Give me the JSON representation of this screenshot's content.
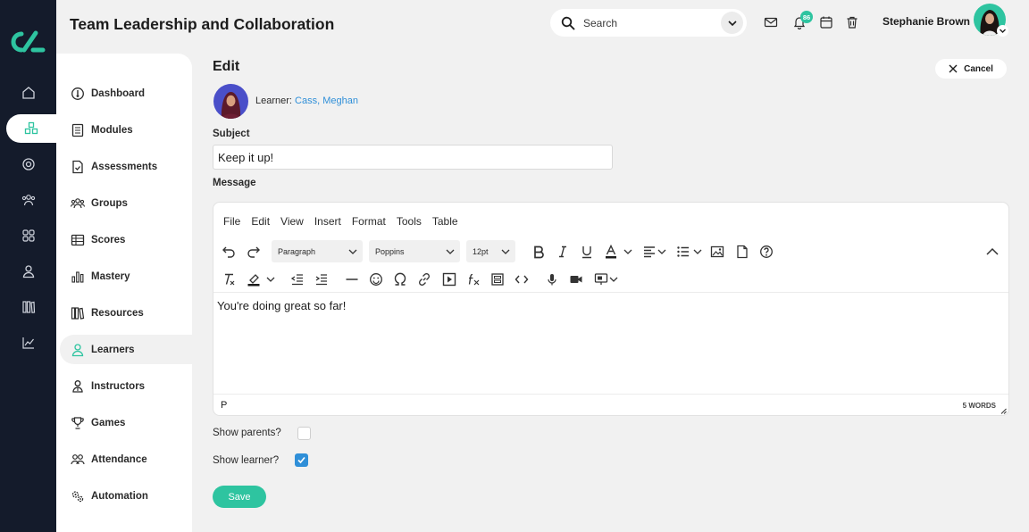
{
  "header": {
    "title": "Team Leadership and Collaboration",
    "search_label": "Search",
    "notification_count": "86",
    "user_name": "Stephanie Brown"
  },
  "rail": {
    "icons": [
      "home-icon",
      "modules-icon",
      "target-icon",
      "people-icon",
      "grid-icon",
      "user-icon",
      "library-icon",
      "chart-icon"
    ],
    "active_index": 1
  },
  "sidebar": {
    "items": [
      {
        "label": "Dashboard",
        "icon": "dashboard-icon"
      },
      {
        "label": "Modules",
        "icon": "book-icon"
      },
      {
        "label": "Assessments",
        "icon": "document-check-icon"
      },
      {
        "label": "Groups",
        "icon": "group-icon"
      },
      {
        "label": "Scores",
        "icon": "table-icon"
      },
      {
        "label": "Mastery",
        "icon": "bar-chart-icon"
      },
      {
        "label": "Resources",
        "icon": "books-icon"
      },
      {
        "label": "Learners",
        "icon": "user-icon"
      },
      {
        "label": "Instructors",
        "icon": "instructor-icon"
      },
      {
        "label": "Games",
        "icon": "trophy-icon"
      },
      {
        "label": "Attendance",
        "icon": "attendance-icon"
      },
      {
        "label": "Automation",
        "icon": "gears-icon"
      }
    ],
    "active": "Learners"
  },
  "main": {
    "heading": "Edit",
    "cancel_label": "Cancel",
    "learner_prefix": "Learner:",
    "learner_name": "Cass, Meghan",
    "subject_label": "Subject",
    "subject_value": "Keep it up!",
    "message_label": "Message",
    "show_parents_label": "Show parents?",
    "show_parents_checked": false,
    "show_learner_label": "Show learner?",
    "show_learner_checked": true,
    "save_label": "Save"
  },
  "editor": {
    "menu": [
      "File",
      "Edit",
      "View",
      "Insert",
      "Format",
      "Tools",
      "Table"
    ],
    "block_format": "Paragraph",
    "font_family": "Poppins",
    "font_size": "12pt",
    "content": "You're doing great so far!",
    "path": "P",
    "word_count": "5 WORDS"
  },
  "colors": {
    "accent": "#2ec4a0",
    "rail": "#141b2b",
    "link": "#2f8fd8"
  }
}
